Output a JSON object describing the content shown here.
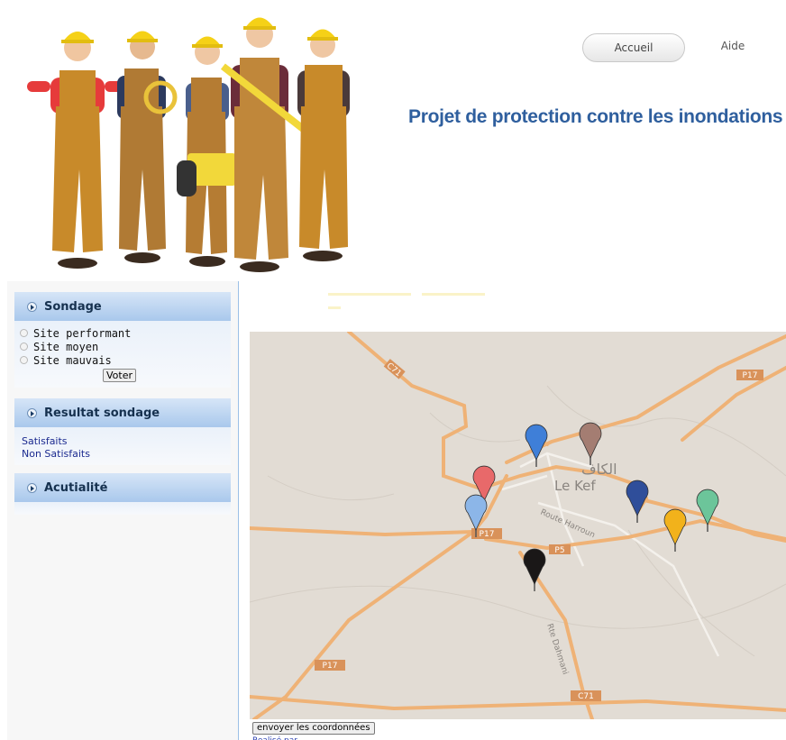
{
  "header": {
    "nav": {
      "home_label": "Accueil",
      "help_label": "Aide"
    },
    "title": "Projet de protection contre les inondations"
  },
  "sidebar": {
    "poll": {
      "title": "Sondage",
      "options": [
        "Site performant",
        "Site moyen",
        "Site mauvais"
      ],
      "vote_label": "Voter"
    },
    "results": {
      "title": "Resultat sondage",
      "items": [
        {
          "label": "Satisfaits",
          "percent": ""
        },
        {
          "label": "Non Satisfaits",
          "percent": ""
        }
      ]
    },
    "news": {
      "title": "Acutialité"
    }
  },
  "map": {
    "city_label_ar": "الكاف",
    "city_label": "Le Kef",
    "road_labels": [
      "C71",
      "P17",
      "P17",
      "P5",
      "P17",
      "C71"
    ],
    "street_labels": [
      "Route Harroun",
      "Rte Dahmani"
    ],
    "markers": [
      {
        "name": "marker-blue",
        "color": "#3f7fd8"
      },
      {
        "name": "marker-brown",
        "color": "#a47d72"
      },
      {
        "name": "marker-red",
        "color": "#e8696a"
      },
      {
        "name": "marker-lightblue",
        "color": "#8cb6e8"
      },
      {
        "name": "marker-navy",
        "color": "#2f4e9a"
      },
      {
        "name": "marker-yellow",
        "color": "#f2b21b"
      },
      {
        "name": "marker-green",
        "color": "#6cc59a"
      },
      {
        "name": "marker-black",
        "color": "#1a1717"
      }
    ]
  },
  "submit_label": "envoyer les coordonnées",
  "footer_link": "Realisé par"
}
